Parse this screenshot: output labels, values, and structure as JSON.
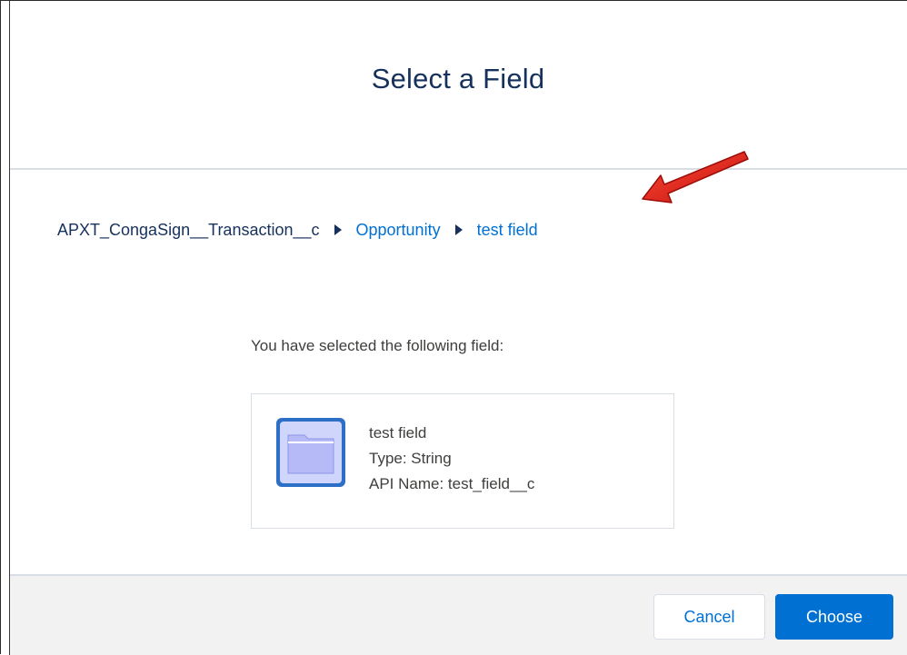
{
  "modal": {
    "title": "Select a Field"
  },
  "breadcrumb": {
    "root": "APXT_CongaSign__Transaction__c",
    "items": [
      "Opportunity",
      "test field"
    ]
  },
  "selection": {
    "label": "You have selected the following field:",
    "field_name": "test field",
    "field_type": "Type: String",
    "api_name": "API Name: test_field__c"
  },
  "footer": {
    "cancel_label": "Cancel",
    "choose_label": "Choose"
  },
  "colors": {
    "link": "#0070d2",
    "title": "#16325c",
    "annotation_arrow": "#e02020",
    "folder_icon": "#b5b8f5"
  },
  "icons": [
    "chevron-right-icon",
    "folder-icon",
    "annotation-arrow-icon"
  ]
}
